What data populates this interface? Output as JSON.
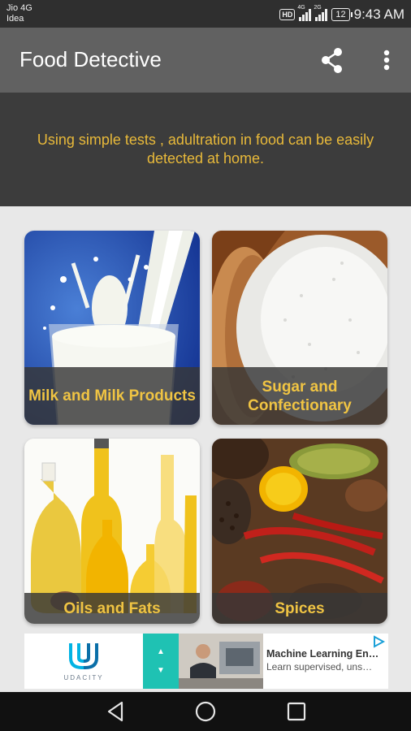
{
  "status_bar": {
    "carrier_1": "Jio 4G",
    "carrier_2": "Idea",
    "hd": "HD",
    "net_1": "4G",
    "net_2": "2G",
    "battery": "12",
    "time": "9:43 AM"
  },
  "app_bar": {
    "title": "Food Detective",
    "share_icon": "share-icon",
    "menu_icon": "more-vert-icon"
  },
  "banner": {
    "text": "Using simple tests , adultration in food can be easily detected at home."
  },
  "categories": [
    {
      "label": "Milk and Milk Products"
    },
    {
      "label": "Sugar and Confectionary"
    },
    {
      "label": "Oils and Fats"
    },
    {
      "label": "Spices"
    }
  ],
  "ad": {
    "brand": "UDACITY",
    "title": "Machine Learning En…",
    "subtitle": "Learn supervised, uns…"
  },
  "colors": {
    "status_bar": "#2f2f2f",
    "app_bar": "#616161",
    "banner_bg": "#3c3c3c",
    "accent_text": "#e8b93a",
    "caption_text": "#f0c443",
    "page_bg": "#e8e8e8",
    "ad_teal": "#1fc2b3",
    "nav_bar": "#111111"
  }
}
